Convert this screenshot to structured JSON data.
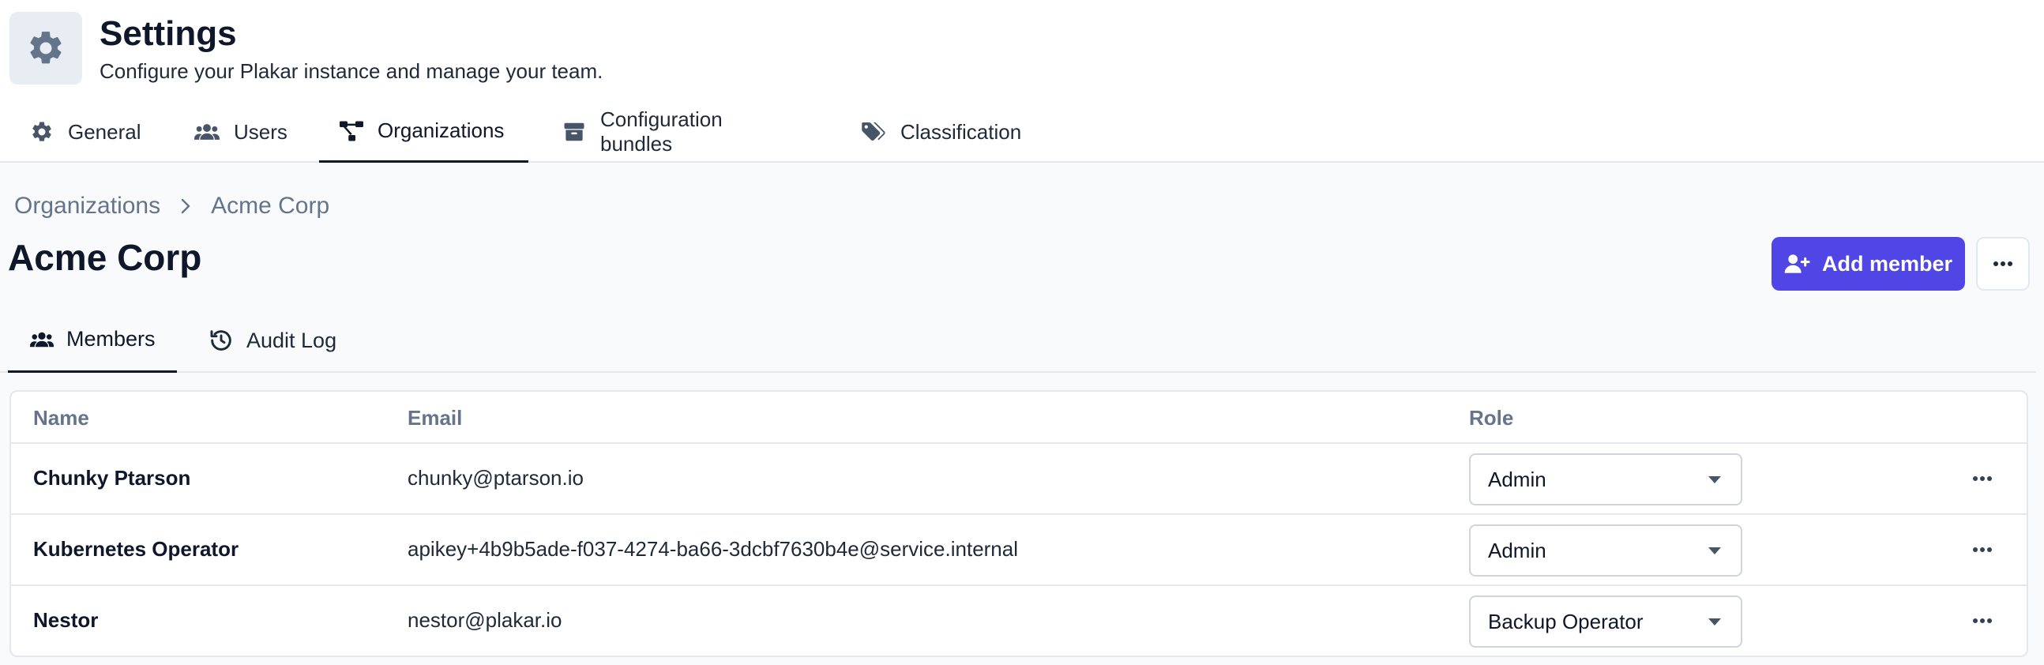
{
  "header": {
    "title": "Settings",
    "subtitle": "Configure your Plakar instance and manage your team."
  },
  "top_tabs": [
    {
      "label": "General",
      "icon": "gear-icon"
    },
    {
      "label": "Users",
      "icon": "users-icon"
    },
    {
      "label": "Organizations",
      "icon": "diagram-icon",
      "active": true
    },
    {
      "label": "Configuration bundles",
      "icon": "box-icon"
    },
    {
      "label": "Classification",
      "icon": "tags-icon"
    }
  ],
  "breadcrumb": {
    "parent": "Organizations",
    "current": "Acme Corp"
  },
  "organization": {
    "title": "Acme Corp"
  },
  "actions": {
    "add_member_label": "Add member"
  },
  "sub_tabs": [
    {
      "label": "Members",
      "icon": "users-icon",
      "active": true
    },
    {
      "label": "Audit Log",
      "icon": "history-icon"
    }
  ],
  "table": {
    "columns": [
      "Name",
      "Email",
      "Role"
    ],
    "rows": [
      {
        "name": "Chunky Ptarson",
        "email": "chunky@ptarson.io",
        "role": "Admin"
      },
      {
        "name": "Kubernetes Operator",
        "email": "apikey+4b9b5ade-f037-4274-ba66-3dcbf7630b4e@service.internal",
        "role": "Admin"
      },
      {
        "name": "Nestor",
        "email": "nestor@plakar.io",
        "role": "Backup Operator"
      }
    ]
  },
  "colors": {
    "accent": "#4f46e5",
    "icon_muted": "#64748b",
    "text_dark": "#0f172a"
  }
}
